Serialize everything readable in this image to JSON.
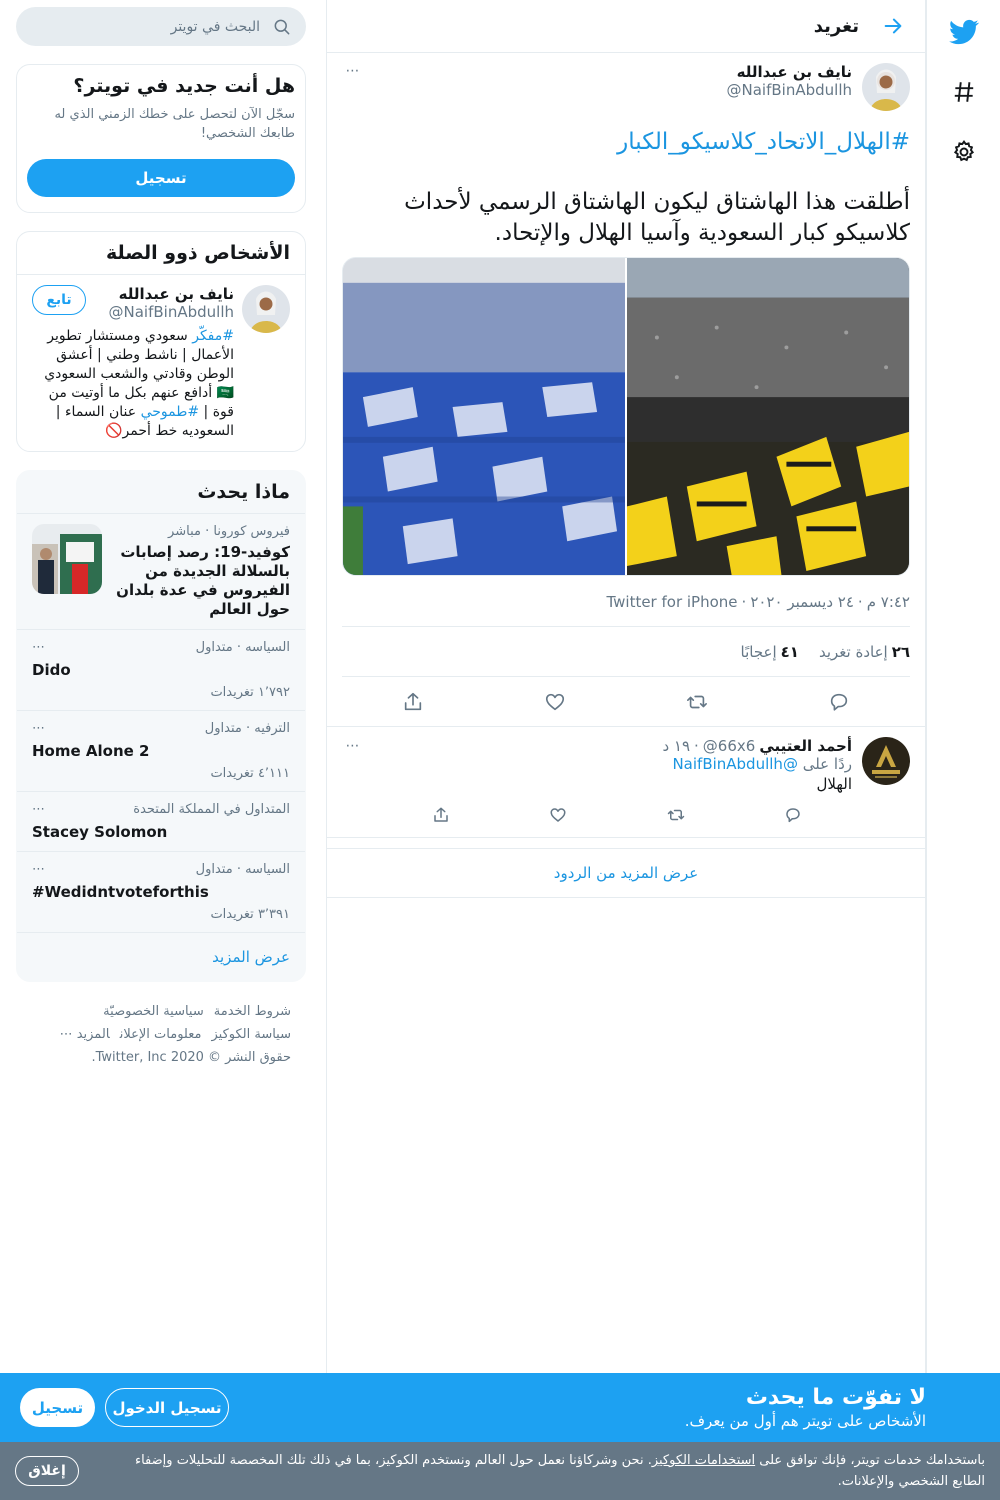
{
  "colors": {
    "brand": "#1da1f2",
    "link": "#1b95e0",
    "muted": "#657786",
    "border": "#e6ecf0",
    "cookie_bg": "#657786"
  },
  "icons": {
    "nav": [
      "twitter-bird-icon",
      "hashtag-icon",
      "settings-gear-icon"
    ],
    "header_back": "arrow-right-icon"
  },
  "header": {
    "title": "تغريد"
  },
  "tweet": {
    "author_name": "نايف بن عبدالله",
    "author_handle": "@NaifBinAbdullh",
    "more": "⋯",
    "hashtag": "#الهلال_الاتحاد_كلاسيكو_الكبار",
    "text": "أطلقت هذا الهاشتاق ليكون الهاشتاق الرسمي لأحداث كلاسيكو كبار السعودية وآسيا الهلال والإتحاد.",
    "time": "٧:٤٢ م",
    "date": "٢٤ ديسمبر ٢٠٢٠",
    "source": "Twitter for iPhone",
    "retweets_count": "٢٦",
    "retweets_label": "إعادة تغريد",
    "likes_count": "٤١",
    "likes_label": "إعجابًا"
  },
  "reply": {
    "author_name": "أحمد العتيبي",
    "author_handle": "@66x6",
    "age": "١٩ د",
    "replying_prefix": "ردًا على",
    "replying_to": "@NaifBinAbdullh",
    "text": "الهلال",
    "more": "⋯"
  },
  "more_replies": "عرض المزيد من الردود",
  "search": {
    "placeholder": "البحث في تويتر"
  },
  "signup_card": {
    "title": "هل أنت جديد في تويتر؟",
    "desc": "سجّل الآن لتحصل على خطك الزمني الذي له طابعك الشخصي!",
    "button": "تسجيل"
  },
  "relevant": {
    "title": "الأشخاص ذوو الصلة",
    "name": "نايف بن عبدالله",
    "handle": "@NaifBinAbdullh",
    "follow": "تابع",
    "bio_tag1": "#مفكّر",
    "bio_part1": " سعودي ومستشار تطوير الأعمال | ناشط وطني | أعشق الوطن وقادتي والشعب السعودي🇸🇦 أدافع عنهم بكل ما أوتيت من قوة | ",
    "bio_tag2": "#طموحي",
    "bio_part2": " عنان السماء | السعوديه خط أحمر🚫"
  },
  "trends": {
    "title": "ماذا يحدث",
    "news": {
      "context": "فيروس كورونا · مباشر",
      "headline": "كوفيد-19: رصد إصابات بالسلالة الجديدة من الفيروس في عدة بلدان حول العالم"
    },
    "items": [
      {
        "context": "السياسه · متداول",
        "title": "Dido",
        "count": "١٬٧٩٢ تغريدات",
        "more": "⋯"
      },
      {
        "context": "الترفيه · متداول",
        "title": "Home Alone 2",
        "count": "٤٬١١١ تغريدات",
        "more": "⋯"
      },
      {
        "context": "المتداول في المملكة المتحدة",
        "title": "Stacey Solomon",
        "count": "",
        "more": "⋯"
      },
      {
        "context": "السياسه · متداول",
        "title": "#Wedidntvoteforthis",
        "count": "٣٬٣٩١ تغريدات",
        "more": "⋯"
      }
    ],
    "show_more": "عرض المزيد"
  },
  "footer": {
    "terms": "شروط الخدمة",
    "privacy": "سياسية الخصوصيّة",
    "cookies": "سياسة الكوكيز",
    "ads": "معلومات الإعلان",
    "more": "المزيد ⋯",
    "copyright": "حقوق النشر © 2020 Twitter, Inc."
  },
  "cta": {
    "heading": "لا تفوّت ما يحدث",
    "sub": "الأشخاص على تويتر هم أول من يعرف.",
    "login": "تسجيل الدخول",
    "signup": "تسجيل"
  },
  "cookie": {
    "text_before": "باستخدامك خدمات تويتر، فإنك توافق على ",
    "link": "استخدامات الكوكيز",
    "text_after": ". نحن وشركاؤنا نعمل حول العالم ونستخدم الكوكيز، بما في ذلك تلك المخصصة للتحليلات وإضفاء الطابع الشخصي والإعلانات.",
    "close": "إغلاق"
  }
}
